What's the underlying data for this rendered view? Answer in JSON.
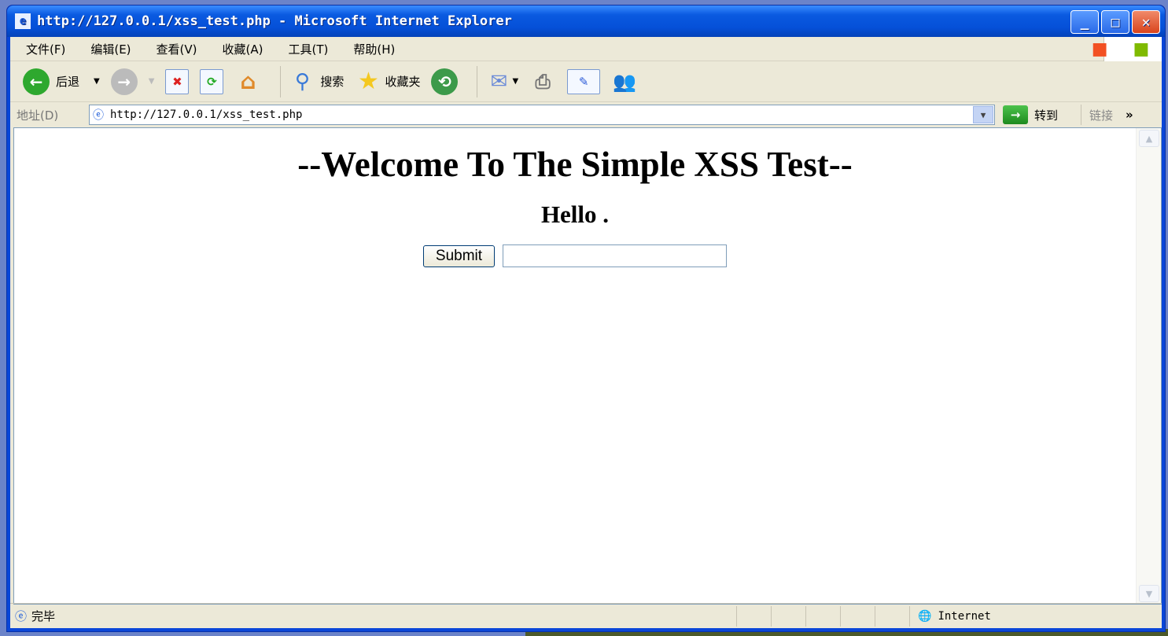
{
  "window": {
    "title": "http://127.0.0.1/xss_test.php - Microsoft Internet Explorer"
  },
  "menu": [
    "文件(F)",
    "编辑(E)",
    "查看(V)",
    "收藏(A)",
    "工具(T)",
    "帮助(H)"
  ],
  "toolbar": {
    "back": "后退",
    "search": "搜索",
    "favorites": "收藏夹"
  },
  "address": {
    "label": "地址(D)",
    "url": "http://127.0.0.1/xss_test.php",
    "go": "转到",
    "links": "链接",
    "more": "»"
  },
  "page": {
    "heading": "--Welcome To The Simple XSS Test--",
    "greeting": "Hello .",
    "submit": "Submit",
    "input_value": ""
  },
  "status": {
    "text": "完毕",
    "zone": "Internet"
  }
}
